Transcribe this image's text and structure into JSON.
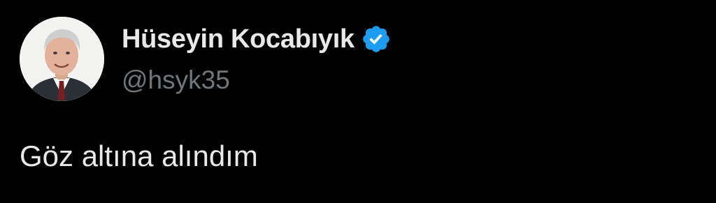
{
  "author": {
    "display_name": "Hüseyin Kocabıyık",
    "handle": "@hsyk35",
    "verified": true,
    "avatar_icon": "profile-photo-avatar",
    "verified_icon": "verified-badge-icon"
  },
  "tweet": {
    "text": "Göz altına alındım"
  },
  "colors": {
    "background": "#000000",
    "primary_text": "#e7e9ea",
    "secondary_text": "#71767b",
    "verified_blue": "#1d9bf0"
  }
}
